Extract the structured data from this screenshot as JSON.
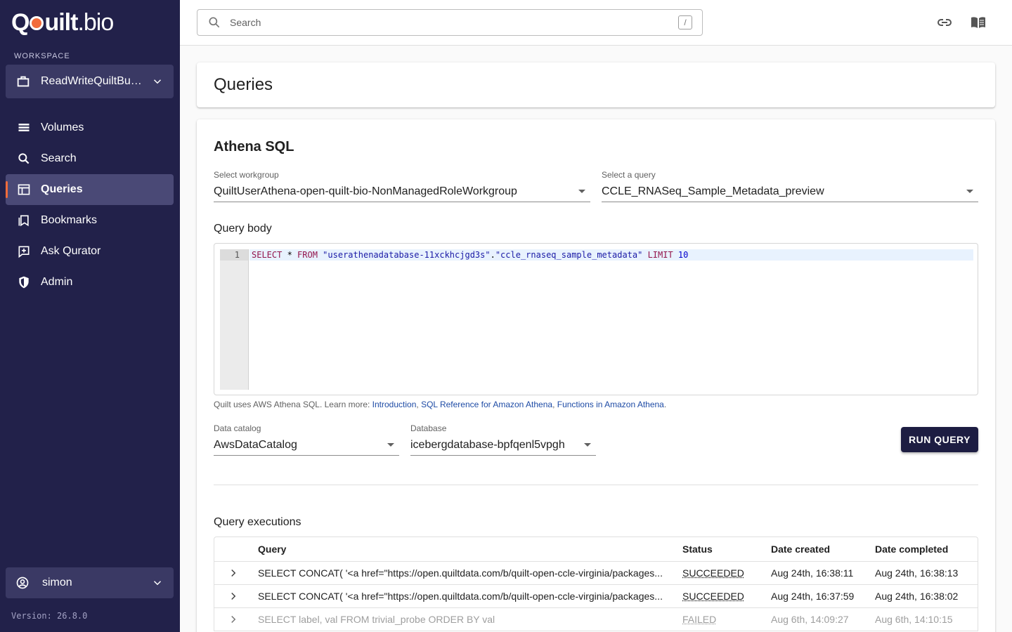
{
  "brand": {
    "logo_text": "Quilt.bio"
  },
  "sidebar": {
    "workspace_label": "WORKSPACE",
    "workspace_name": "ReadWriteQuiltBuck...",
    "items": [
      {
        "label": "Volumes",
        "icon": "volumes-icon"
      },
      {
        "label": "Search",
        "icon": "search-icon"
      },
      {
        "label": "Queries",
        "icon": "table-icon",
        "active": true
      },
      {
        "label": "Bookmarks",
        "icon": "bookmark-icon"
      },
      {
        "label": "Ask Qurator",
        "icon": "qurator-icon"
      },
      {
        "label": "Admin",
        "icon": "shield-icon"
      }
    ],
    "user": "simon",
    "version": "Version: 26.8.0"
  },
  "topbar": {
    "search_placeholder": "Search",
    "search_shortcut": "/"
  },
  "page": {
    "title": "Queries"
  },
  "athena": {
    "title": "Athena SQL",
    "workgroup_label": "Select workgroup",
    "workgroup_value": "QuiltUserAthena-open-quilt-bio-NonManagedRoleWorkgroup",
    "query_label": "Select a query",
    "query_value": "CCLE_RNASeq_Sample_Metadata_preview",
    "body_label": "Query body",
    "editor": {
      "line_number": "1",
      "tokens": {
        "select": "SELECT",
        "star": " * ",
        "from": "FROM",
        "db": " \"userathenadatabase-11xckhcjgd3s\"",
        "dot": ".",
        "table": "\"ccle_rnaseq_sample_metadata\"",
        "limit": " LIMIT",
        "limit_val": " 10"
      }
    },
    "help": {
      "prefix": "Quilt uses AWS Athena SQL. Learn more: ",
      "link1": "Introduction",
      "sep1": ", ",
      "link2": "SQL Reference for Amazon Athena",
      "sep2": ", ",
      "link3": "Functions in Amazon Athena",
      "suffix": "."
    },
    "catalog_label": "Data catalog",
    "catalog_value": "AwsDataCatalog",
    "database_label": "Database",
    "database_value": "icebergdatabase-bpfqenl5vpgh",
    "run_button": "RUN QUERY"
  },
  "executions": {
    "title": "Query executions",
    "columns": [
      "Query",
      "Status",
      "Date created",
      "Date completed"
    ],
    "rows": [
      {
        "query": "SELECT CONCAT( '<a href=\"https://open.quiltdata.com/b/quilt-open-ccle-virginia/packages...",
        "status": "SUCCEEDED",
        "created": "Aug 24th, 16:38:11",
        "completed": "Aug 24th, 16:38:13",
        "failed": false
      },
      {
        "query": "SELECT CONCAT( '<a href=\"https://open.quiltdata.com/b/quilt-open-ccle-virginia/packages...",
        "status": "SUCCEEDED",
        "created": "Aug 24th, 16:37:59",
        "completed": "Aug 24th, 16:38:02",
        "failed": false
      },
      {
        "query": "SELECT label, val FROM trivial_probe ORDER BY val",
        "status": "FAILED",
        "created": "Aug 6th, 14:09:27",
        "completed": "Aug 6th, 14:10:15",
        "failed": true
      }
    ]
  },
  "colors": {
    "sidebar_bg": "#22214a",
    "accent": "#f26b3a",
    "button_bg": "#1d1d42",
    "link": "#1e4ba5"
  }
}
